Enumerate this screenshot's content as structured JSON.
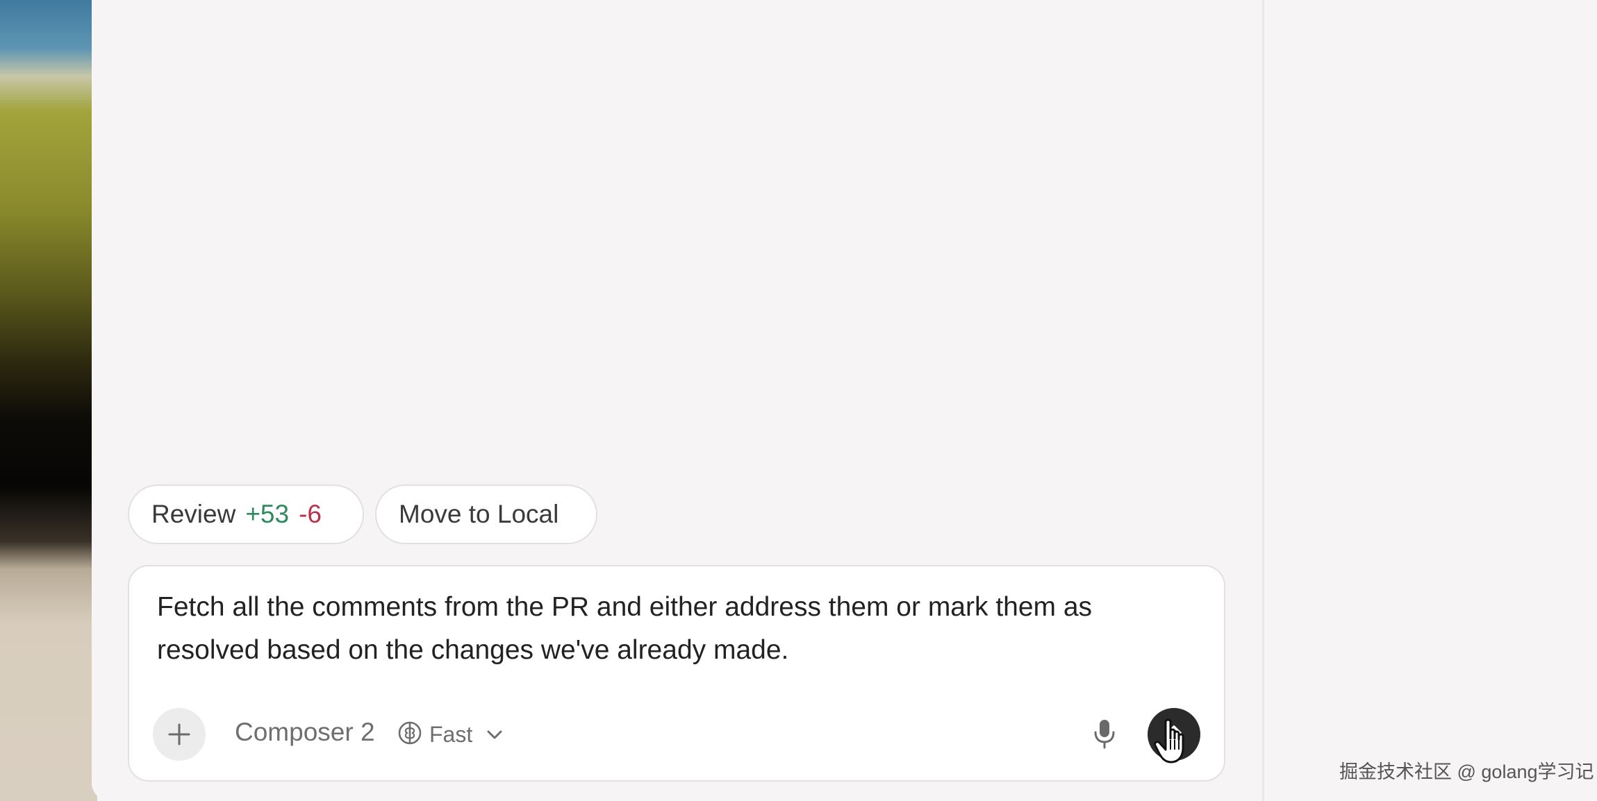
{
  "actions": {
    "review": {
      "label": "Review",
      "additions": "+53",
      "deletions": "-6"
    },
    "move_to_local": {
      "label": "Move to Local"
    }
  },
  "composer": {
    "prompt": "Fetch all the comments from the PR and either address them or mark them as resolved based on the changes we've already made.",
    "model": "Composer 2",
    "speed": "Fast"
  },
  "icons": {
    "add": "plus-icon",
    "model_mode": "brain-icon",
    "dropdown": "chevron-down-icon",
    "voice": "microphone-icon",
    "send": "send-icon",
    "pointer": "hand-cursor-icon"
  },
  "colors": {
    "additions": "#2f8a5e",
    "deletions": "#b8334a",
    "send_button": "#2b2b2b"
  },
  "watermark": "掘金技术社区 @ golang学习记"
}
